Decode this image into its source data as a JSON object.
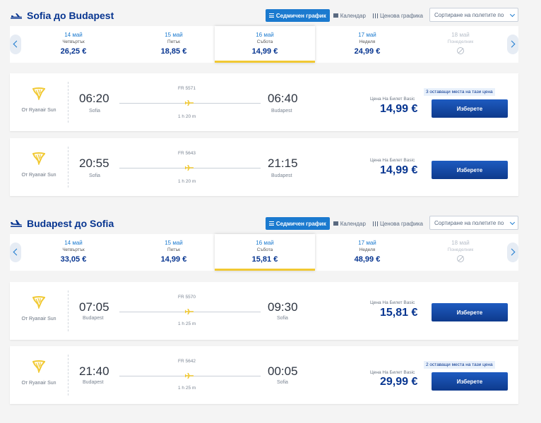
{
  "colors": {
    "primary": "#073590",
    "accent": "#1b7acf",
    "highlight": "#f1c933",
    "ryanair_yellow": "#f1c933"
  },
  "view_labels": {
    "weekly": "Седмичен график",
    "calendar": "Календар",
    "price_chart": "Ценова графика"
  },
  "sort_label": "Сортиране на полетите по",
  "outbound": {
    "title": "Sofia до Budapest",
    "dates": [
      {
        "date": "14 май",
        "weekday": "Четвъртък",
        "price": "26,25 €"
      },
      {
        "date": "15 май",
        "weekday": "Петък",
        "price": "18,85 €"
      },
      {
        "date": "16 май",
        "weekday": "Събота",
        "price": "14,99 €"
      },
      {
        "date": "17 май",
        "weekday": "Неделя",
        "price": "24,99 €"
      },
      {
        "date": "18 май",
        "weekday": "Понеделник",
        "price": ""
      }
    ],
    "flights": [
      {
        "operator": "От Ryanair Sun",
        "flight_no": "FR 5571",
        "dep_time": "06:20",
        "dep_city": "Sofia",
        "arr_time": "06:40",
        "arr_city": "Budapest",
        "duration": "1 h 20 m",
        "fare_label": "Цена На Билет Basic",
        "price": "14,99 €",
        "seats_note": "3 оставащи места на тази цена",
        "button": "Изберете"
      },
      {
        "operator": "От Ryanair Sun",
        "flight_no": "FR 5643",
        "dep_time": "20:55",
        "dep_city": "Sofia",
        "arr_time": "21:15",
        "arr_city": "Budapest",
        "duration": "1 h 20 m",
        "fare_label": "Цена На Билет Basic",
        "price": "14,99 €",
        "seats_note": "",
        "button": "Изберете"
      }
    ]
  },
  "inbound": {
    "title": "Budapest до Sofia",
    "dates": [
      {
        "date": "14 май",
        "weekday": "Четвъртък",
        "price": "33,05 €"
      },
      {
        "date": "15 май",
        "weekday": "Петък",
        "price": "14,99 €"
      },
      {
        "date": "16 май",
        "weekday": "Събота",
        "price": "15,81 €"
      },
      {
        "date": "17 май",
        "weekday": "Неделя",
        "price": "48,99 €"
      },
      {
        "date": "18 май",
        "weekday": "Понеделник",
        "price": ""
      }
    ],
    "flights": [
      {
        "operator": "От Ryanair Sun",
        "flight_no": "FR 5570",
        "dep_time": "07:05",
        "dep_city": "Budapest",
        "arr_time": "09:30",
        "arr_city": "Sofia",
        "duration": "1 h 25 m",
        "fare_label": "Цена На Билет Basic",
        "price": "15,81 €",
        "seats_note": "",
        "button": "Изберете"
      },
      {
        "operator": "От Ryanair Sun",
        "flight_no": "FR 5642",
        "dep_time": "21:40",
        "dep_city": "Budapest",
        "arr_time": "00:05",
        "arr_city": "Sofia",
        "duration": "1 h 25 m",
        "fare_label": "Цена На Билет Basic",
        "price": "29,99 €",
        "seats_note": "2 оставащи места на тази цена",
        "button": "Изберете"
      }
    ]
  }
}
